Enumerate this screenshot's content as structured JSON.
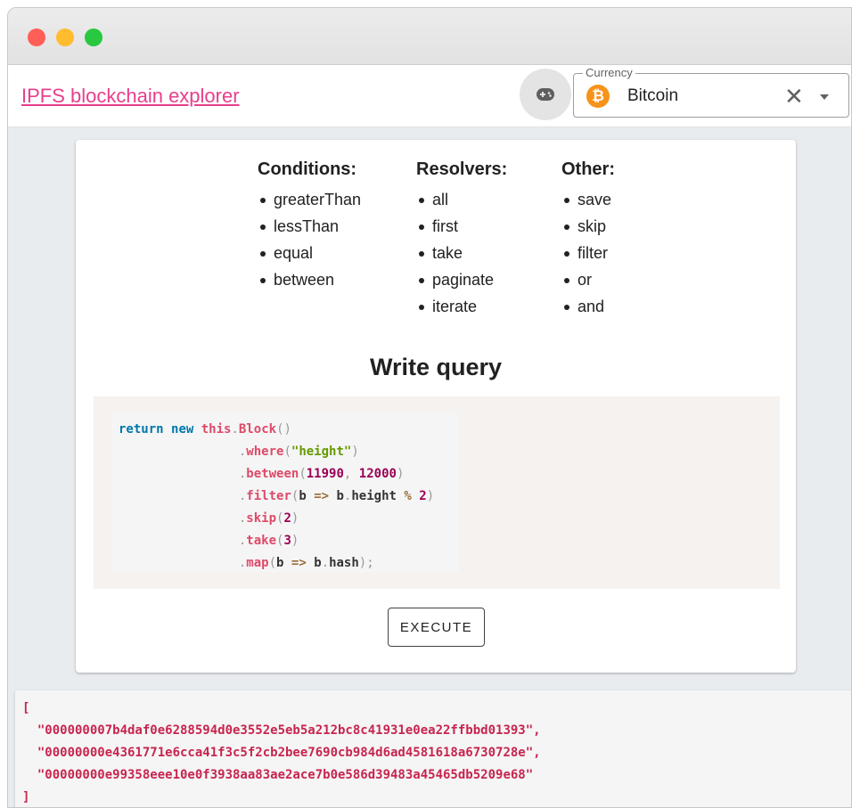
{
  "appbar": {
    "home_link": "IPFS blockchain explorer",
    "playground_icon": "gamepad-icon",
    "currency": {
      "legend": "Currency",
      "selected": "Bitcoin",
      "icon": "bitcoin-icon",
      "icon_symbol": "₿",
      "clear_symbol": "✕"
    }
  },
  "help": {
    "conditions": {
      "title": "Conditions:",
      "items": [
        "greaterThan",
        "lessThan",
        "equal",
        "between"
      ]
    },
    "resolvers": {
      "title": "Resolvers:",
      "items": [
        "all",
        "first",
        "take",
        "paginate",
        "iterate"
      ]
    },
    "other": {
      "title": "Other:",
      "items": [
        "save",
        "skip",
        "filter",
        "or",
        "and"
      ]
    }
  },
  "query": {
    "title": "Write query",
    "code_lines": [
      "return new this.Block()",
      "                .where(\"height\")",
      "                .between(11990, 12000)",
      "                .filter(b => b.height % 2)",
      "                .skip(2)",
      "                .take(3)",
      "                .map(b => b.hash);"
    ],
    "execute_label": "EXECUTE"
  },
  "result": {
    "open": "[",
    "hashes": [
      "\"000000007b4daf0e6288594d0e3552e5eb5a212bc8c41931e0ea22ffbbd01393\",",
      "\"00000000e4361771e6cca41f3c5f2cb2bee7690cb984d6ad4581618a6730728e\",",
      "\"00000000e99358eee10e0f3938aa83ae2ace7b0e586d39483a45465db5209e68\""
    ],
    "close": "]"
  },
  "colors": {
    "link": "#e83e8c",
    "bitcoin": "#f7931a",
    "result_text": "#c7254e"
  }
}
